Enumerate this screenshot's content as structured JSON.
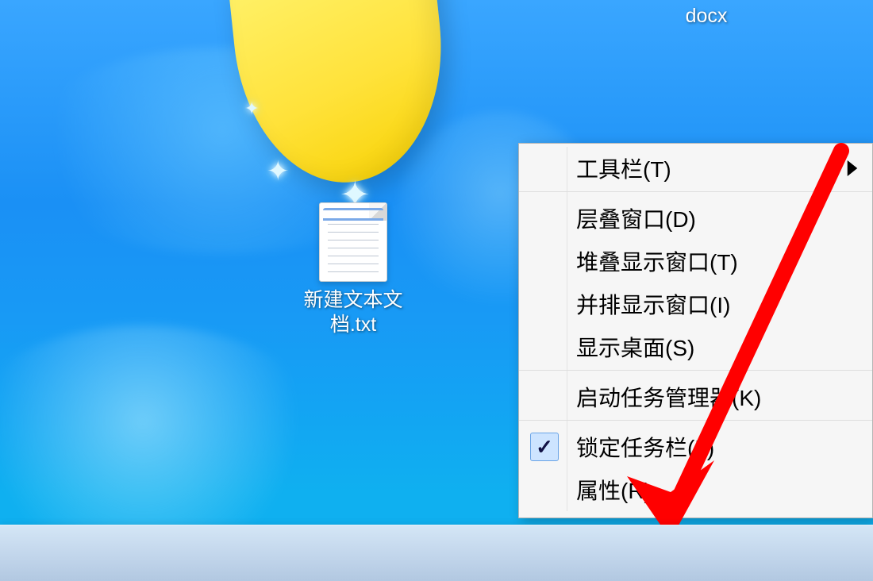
{
  "desktop": {
    "top_file_label": "docx",
    "file_label_line1": "新建文本文",
    "file_label_line2": "档.txt"
  },
  "context_menu": {
    "items": [
      {
        "label": "工具栏(T)",
        "has_submenu": true
      },
      {
        "label": "层叠窗口(D)"
      },
      {
        "label": "堆叠显示窗口(T)"
      },
      {
        "label": "并排显示窗口(I)"
      },
      {
        "label": "显示桌面(S)"
      },
      {
        "label": "启动任务管理器(K)"
      },
      {
        "label": "锁定任务栏(L)",
        "checked": true
      },
      {
        "label": "属性(R)"
      }
    ]
  }
}
